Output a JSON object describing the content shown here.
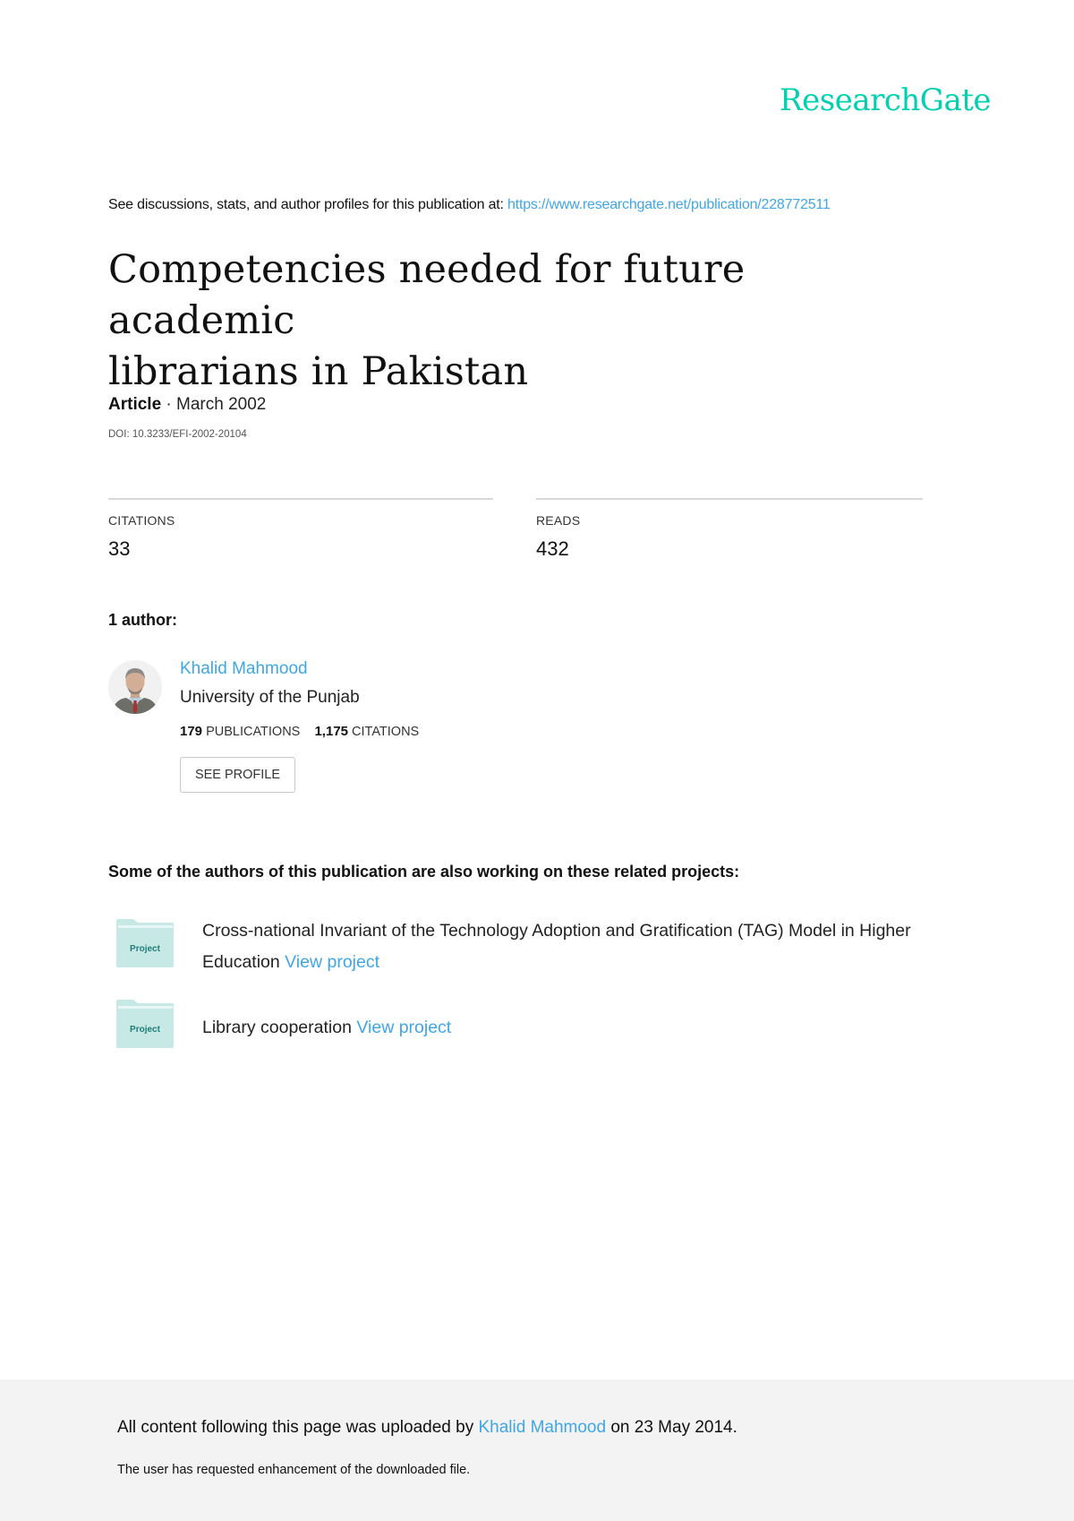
{
  "brand": {
    "name": "ResearchGate",
    "color": "#00d0af"
  },
  "intro": {
    "text": "See discussions, stats, and author profiles for this publication at: ",
    "url": "https://www.researchgate.net/publication/228772511"
  },
  "publication": {
    "title_line1": "Competencies needed for future academic",
    "title_line2": "librarians in Pakistan",
    "type": "Article",
    "separator": " · ",
    "date": "March 2002",
    "doi": "DOI: 10.3233/EFI-2002-20104"
  },
  "stats": {
    "citations_label": "CITATIONS",
    "citations_value": "33",
    "reads_label": "READS",
    "reads_value": "432"
  },
  "authors": {
    "heading": "1 author:",
    "list": [
      {
        "name": "Khalid Mahmood",
        "institution": "University of the Punjab",
        "publications_count": "179",
        "publications_label": "PUBLICATIONS",
        "citations_count": "1,175",
        "citations_label": "CITATIONS",
        "button_label": "SEE PROFILE"
      }
    ]
  },
  "related": {
    "heading": "Some of the authors of this publication are also working on these related projects:",
    "icon_label": "Project",
    "projects": [
      {
        "title_line1": "Cross-national Invariant of the Technology Adoption and Gratification (TAG) Model in Higher",
        "title_line2": "Education ",
        "link_label": "View project"
      },
      {
        "title_line1": "Library cooperation ",
        "link_label": "View project"
      }
    ]
  },
  "footer": {
    "uploaded_prefix": "All content following this page was uploaded by ",
    "uploader": "Khalid Mahmood",
    "uploaded_suffix": " on 23 May 2014.",
    "note": "The user has requested enhancement of the downloaded file."
  },
  "colors": {
    "link": "#40a6e6",
    "footer_bg": "#f3f3f3",
    "project_icon": "#c6e9e6",
    "project_icon_text": "#1f7d78"
  }
}
